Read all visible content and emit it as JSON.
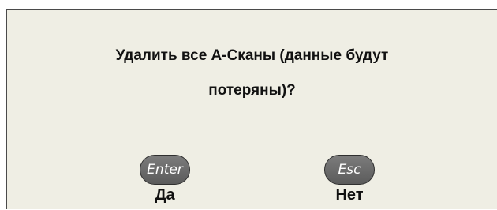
{
  "dialog": {
    "message_line1": "Удалить все А-Сканы (данные будут",
    "message_line2": "потеряны)?",
    "buttons": {
      "yes": {
        "key": "Enter",
        "label": "Да"
      },
      "no": {
        "key": "Esc",
        "label": "Нет"
      }
    }
  }
}
